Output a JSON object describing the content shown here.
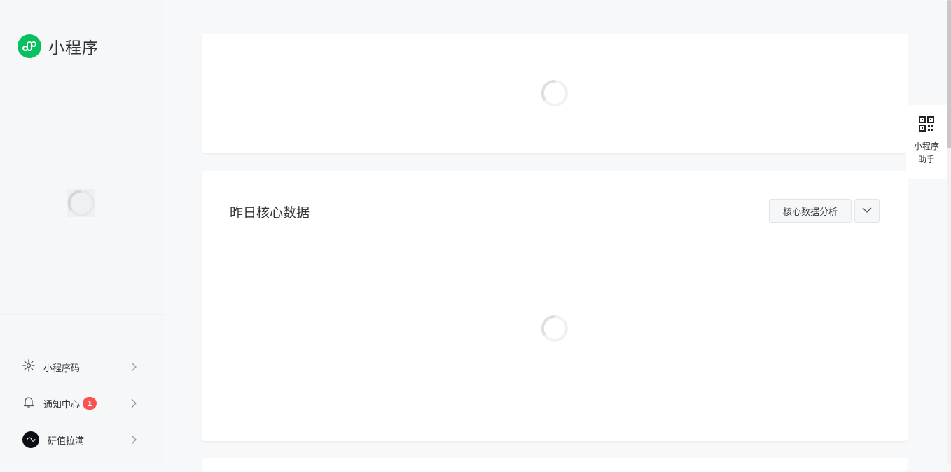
{
  "app": {
    "title": "小程序"
  },
  "sidebar": {
    "links": [
      {
        "label": "小程序码"
      },
      {
        "label": "通知中心",
        "badge": "1"
      },
      {
        "label": "研值拉满"
      }
    ]
  },
  "main": {
    "core_card": {
      "title": "昨日核心数据",
      "analysis_button": "核心数据分析"
    }
  },
  "float_panel": {
    "label_line1": "小程序",
    "label_line2": "助手"
  },
  "colors": {
    "brand": "#07c160",
    "badge": "#fa5151"
  }
}
